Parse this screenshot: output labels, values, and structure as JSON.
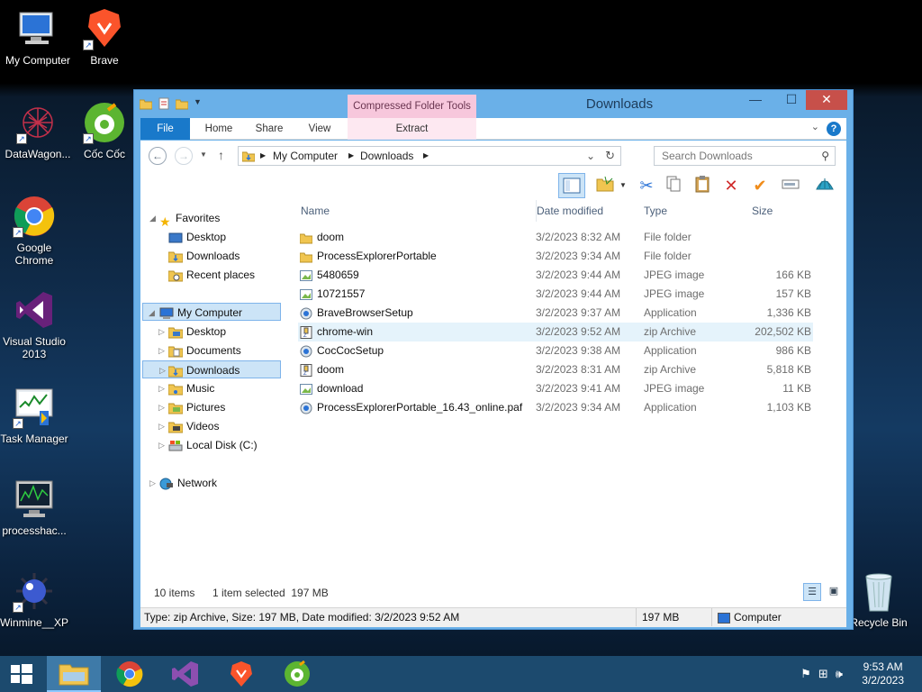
{
  "desktop": {
    "icons": [
      {
        "label": "My Computer",
        "icon": "computer-icon"
      },
      {
        "label": "Brave",
        "icon": "brave-icon"
      },
      {
        "label": "DataWagon...",
        "icon": "datawagon-icon"
      },
      {
        "label": "Cốc Cốc",
        "icon": "coccoc-icon"
      },
      {
        "label": "Google Chrome",
        "icon": "chrome-icon"
      },
      {
        "label": "Visual Studio 2013",
        "icon": "visual-studio-icon"
      },
      {
        "label": "Task Manager",
        "icon": "task-manager-icon"
      },
      {
        "label": "processhac...",
        "icon": "processhacker-icon"
      },
      {
        "label": "Winmine__XP",
        "icon": "winmine-icon"
      },
      {
        "label": "Recycle Bin",
        "icon": "recycle-bin-icon"
      }
    ]
  },
  "window": {
    "title": "Downloads",
    "contextual_tab_group": "Compressed Folder Tools",
    "ribbon_tabs": [
      "File",
      "Home",
      "Share",
      "View",
      "Extract"
    ],
    "address": {
      "crumbs": [
        "My Computer",
        "Downloads"
      ]
    },
    "search": {
      "placeholder": "Search Downloads"
    },
    "navpane": {
      "favorites": "Favorites",
      "favorite_items": [
        "Desktop",
        "Downloads",
        "Recent places"
      ],
      "computer": "My Computer",
      "computer_items": [
        "Desktop",
        "Documents",
        "Downloads",
        "Music",
        "Pictures",
        "Videos",
        "Local Disk (C:)"
      ],
      "network": "Network"
    },
    "columns": [
      "Name",
      "Date modified",
      "Type",
      "Size"
    ],
    "files": [
      {
        "name": "doom",
        "date": "3/2/2023 8:32 AM",
        "type": "File folder",
        "size": ""
      },
      {
        "name": "ProcessExplorerPortable",
        "date": "3/2/2023 9:34 AM",
        "type": "File folder",
        "size": ""
      },
      {
        "name": "5480659",
        "date": "3/2/2023 9:44 AM",
        "type": "JPEG image",
        "size": "166 KB"
      },
      {
        "name": "10721557",
        "date": "3/2/2023 9:44 AM",
        "type": "JPEG image",
        "size": "157 KB"
      },
      {
        "name": "BraveBrowserSetup",
        "date": "3/2/2023 9:37 AM",
        "type": "Application",
        "size": "1,336 KB"
      },
      {
        "name": "chrome-win",
        "date": "3/2/2023 9:52 AM",
        "type": "zip Archive",
        "size": "202,502 KB"
      },
      {
        "name": "CocCocSetup",
        "date": "3/2/2023 9:38 AM",
        "type": "Application",
        "size": "986 KB"
      },
      {
        "name": "doom",
        "date": "3/2/2023 8:31 AM",
        "type": "zip Archive",
        "size": "5,818 KB"
      },
      {
        "name": "download",
        "date": "3/2/2023 9:41 AM",
        "type": "JPEG image",
        "size": "11 KB"
      },
      {
        "name": "ProcessExplorerPortable_16.43_online.paf",
        "date": "3/2/2023 9:34 AM",
        "type": "Application",
        "size": "1,103 KB"
      }
    ],
    "status": {
      "item_count": "10 items",
      "selected": "1 item selected  197 MB",
      "details": "Type: zip Archive, Size: 197 MB, Date modified: 3/2/2023 9:52 AM",
      "size": "197 MB",
      "location": "Computer"
    }
  },
  "taskbar": {
    "time": "9:53 AM",
    "date": "3/2/2023"
  }
}
